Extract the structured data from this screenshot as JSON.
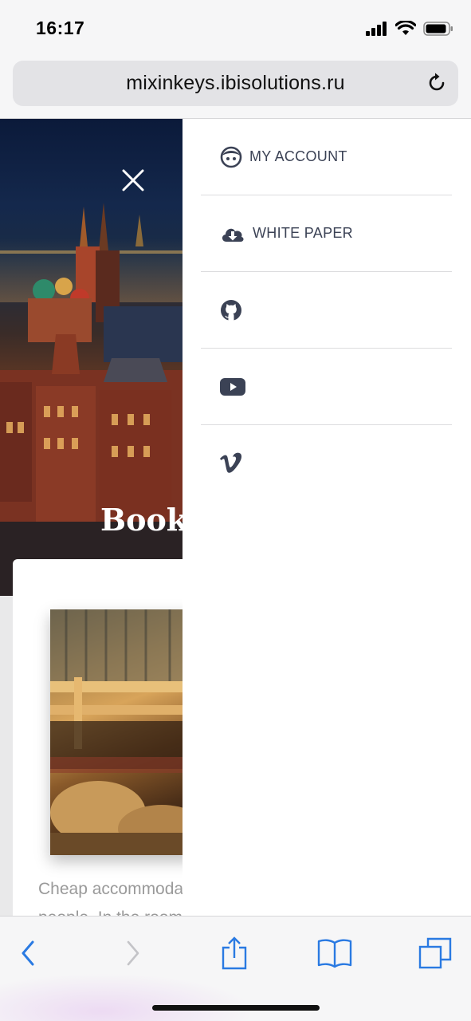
{
  "status_bar": {
    "time": "16:17"
  },
  "browser": {
    "url": "mixinkeys.ibisolutions.ru"
  },
  "hero": {
    "title": "Booki"
  },
  "card": {
    "text_line1": "Cheap accommoda",
    "text_line2": "people. In the room"
  },
  "menu": {
    "items": [
      {
        "label": "MY ACCOUNT",
        "icon": "user-face-icon"
      },
      {
        "label": "WHITE PAPER",
        "icon": "cloud-download-icon"
      },
      {
        "label": "",
        "icon": "github-icon"
      },
      {
        "label": "",
        "icon": "youtube-icon"
      },
      {
        "label": "",
        "icon": "vimeo-icon"
      }
    ]
  },
  "colors": {
    "accent": "#2a7ae2",
    "menu_text": "#3b4255",
    "icon": "#3b4255"
  }
}
